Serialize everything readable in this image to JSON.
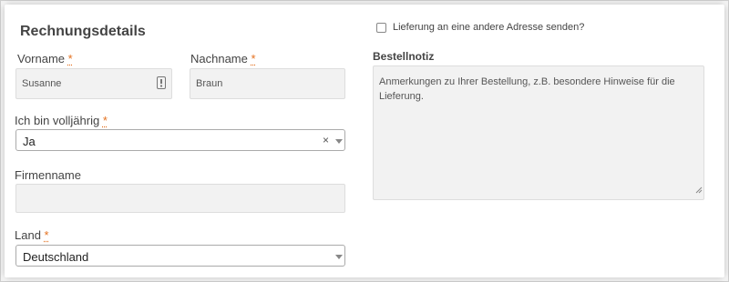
{
  "section_title": "Rechnungsdetails",
  "required_mark": "*",
  "accent_color": "#e4711f",
  "fields": {
    "vorname": {
      "label": "Vorname",
      "value": "Susanne",
      "icon": "contact-card-icon"
    },
    "nachname": {
      "label": "Nachname",
      "value": "Braun"
    },
    "volljaehrig": {
      "label": "Ich bin volljährig",
      "value": "Ja",
      "clear": "×"
    },
    "firmenname": {
      "label": "Firmenname",
      "value": ""
    },
    "land": {
      "label": "Land",
      "value": "Deutschland"
    }
  },
  "shipping": {
    "checkbox_label": "Lieferung an eine andere Adresse senden?",
    "checked": false
  },
  "notes": {
    "label": "Bestellnotiz",
    "placeholder": "Anmerkungen zu Ihrer Bestellung, z.B. besondere Hinweise für die Lieferung."
  }
}
